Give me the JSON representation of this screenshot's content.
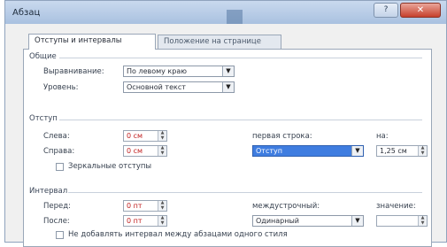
{
  "window": {
    "title": "Абзац",
    "help_label": "?",
    "close_label": "✕"
  },
  "tabs": {
    "indents": "Отступы и интервалы",
    "pagination": "Положение на странице"
  },
  "general": {
    "heading": "Общие",
    "alignment_label": "Выравнивание:",
    "alignment_value": "По левому краю",
    "level_label": "Уровень:",
    "level_value": "Основной текст"
  },
  "indent": {
    "heading": "Отступ",
    "left_label": "Слева:",
    "left_value": "0 см",
    "right_label": "Справа:",
    "right_value": "0 см",
    "first_line_label": "первая строка:",
    "first_line_value": "Отступ",
    "by_label": "на:",
    "by_value": "1,25 см",
    "mirror_label": "Зеркальные отступы"
  },
  "spacing": {
    "heading": "Интервал",
    "before_label": "Перед:",
    "before_value": "0 пт",
    "after_label": "После:",
    "after_value": "0 пт",
    "line_label": "междустрочный:",
    "line_value": "Одинарный",
    "value_label": "значение:",
    "no_add_label": "Не добавлять интервал между абзацами одного стиля"
  },
  "colors": {
    "selection": "#3f7de0",
    "close": "#c7402c",
    "value_red": "#c02020"
  }
}
